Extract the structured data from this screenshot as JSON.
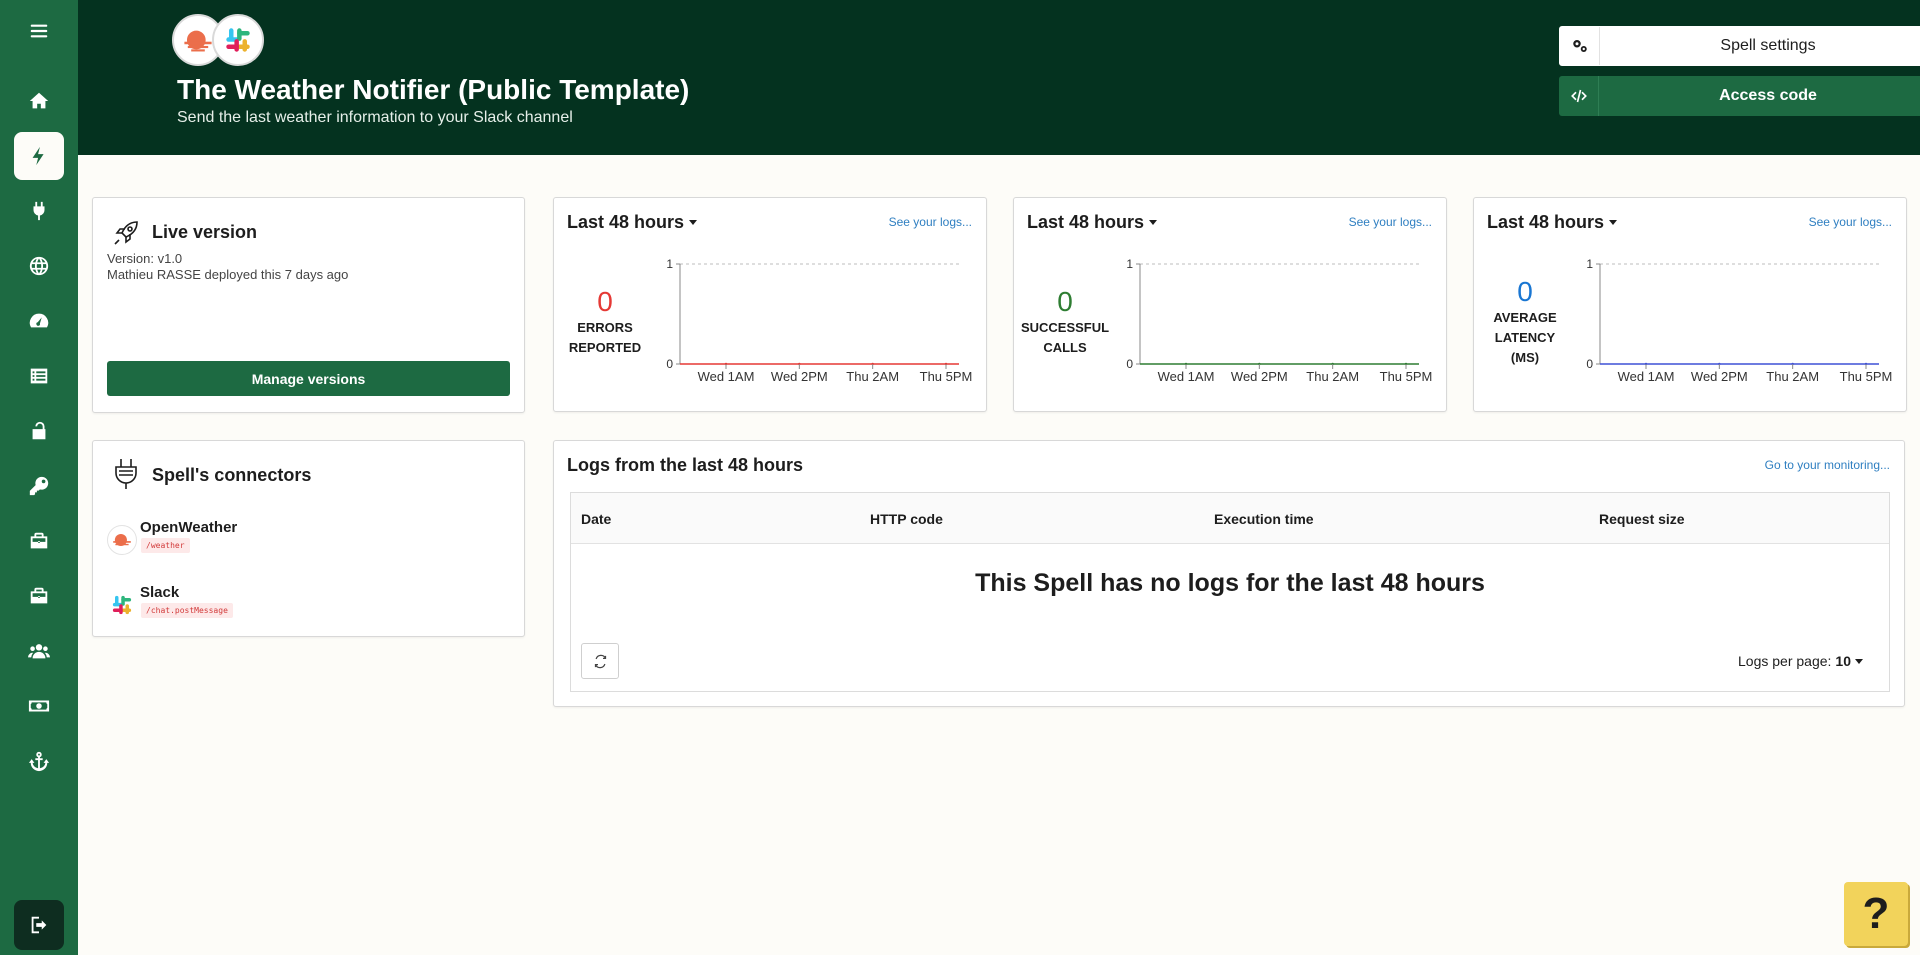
{
  "sidebar": {
    "items": [
      {
        "icon": "menu-icon",
        "label": "Menu"
      },
      {
        "icon": "home-icon",
        "label": "Home"
      },
      {
        "icon": "lightning-icon",
        "label": "Spells",
        "active": true
      },
      {
        "icon": "plug-icon",
        "label": "Connectors"
      },
      {
        "icon": "globe-icon",
        "label": "Web"
      },
      {
        "icon": "dashboard-icon",
        "label": "Monitoring"
      },
      {
        "icon": "list-icon",
        "label": "Logs"
      },
      {
        "icon": "lock-icon",
        "label": "Security"
      },
      {
        "icon": "key-icon",
        "label": "Keys"
      },
      {
        "icon": "briefcase-icon",
        "label": "Workspace"
      },
      {
        "icon": "briefcase-icon",
        "label": "Projects"
      },
      {
        "icon": "users-icon",
        "label": "Team"
      },
      {
        "icon": "money-icon",
        "label": "Billing"
      },
      {
        "icon": "anchor-icon",
        "label": "Webhooks"
      }
    ],
    "logout_icon": "logout-icon"
  },
  "header": {
    "title": "The Weather Notifier (Public Template)",
    "subtitle": "Send the last weather information to your Slack channel",
    "settings_label": "Spell settings",
    "access_label": "Access code"
  },
  "live_version": {
    "title": "Live version",
    "version": "Version: v1.0",
    "deployed": "Mathieu RASSE deployed this 7 days ago",
    "manage_label": "Manage versions"
  },
  "connectors": {
    "title": "Spell's connectors",
    "items": [
      {
        "name": "OpenWeather",
        "path": "/weather"
      },
      {
        "name": "Slack",
        "path": "/chat.postMessage"
      }
    ]
  },
  "metrics": [
    {
      "period": "Last 48 hours",
      "see_logs": "See your logs...",
      "value": "0",
      "label": "ERRORS REPORTED",
      "color": "#e53935"
    },
    {
      "period": "Last 48 hours",
      "see_logs": "See your logs...",
      "value": "0",
      "label": "SUCCESSFUL CALLS",
      "color": "#2e7d32"
    },
    {
      "period": "Last 48 hours",
      "see_logs": "See your logs...",
      "value": "0",
      "label": "AVERAGE LATENCY (MS)",
      "color": "#1976d2"
    }
  ],
  "chart_data": [
    {
      "type": "line",
      "x": [
        "Wed 1AM",
        "Wed 2PM",
        "Thu 2AM",
        "Thu 5PM"
      ],
      "yticks": [
        "0",
        "1"
      ],
      "ylim": [
        0,
        1
      ],
      "series": [
        {
          "values": [
            0,
            0,
            0,
            0
          ],
          "color": "#e53935"
        }
      ]
    },
    {
      "type": "line",
      "x": [
        "Wed 1AM",
        "Wed 2PM",
        "Thu 2AM",
        "Thu 5PM"
      ],
      "yticks": [
        "0",
        "1"
      ],
      "ylim": [
        0,
        1
      ],
      "series": [
        {
          "values": [
            0,
            0,
            0,
            0
          ],
          "color": "#2e7d32"
        }
      ]
    },
    {
      "type": "line",
      "x": [
        "Wed 1AM",
        "Wed 2PM",
        "Thu 2AM",
        "Thu 5PM"
      ],
      "yticks": [
        "0",
        "1"
      ],
      "ylim": [
        0,
        1
      ],
      "series": [
        {
          "values": [
            0,
            0,
            0,
            0
          ],
          "color": "#3f51d6"
        }
      ]
    }
  ],
  "logs": {
    "title": "Logs from the last 48 hours",
    "monitoring_link": "Go to your monitoring...",
    "columns": [
      "Date",
      "HTTP code",
      "Execution time",
      "Request size"
    ],
    "empty_message": "This Spell has no logs for the last 48 hours",
    "per_page_label": "Logs per page:",
    "per_page_value": "10"
  },
  "help": {
    "label": "?"
  }
}
